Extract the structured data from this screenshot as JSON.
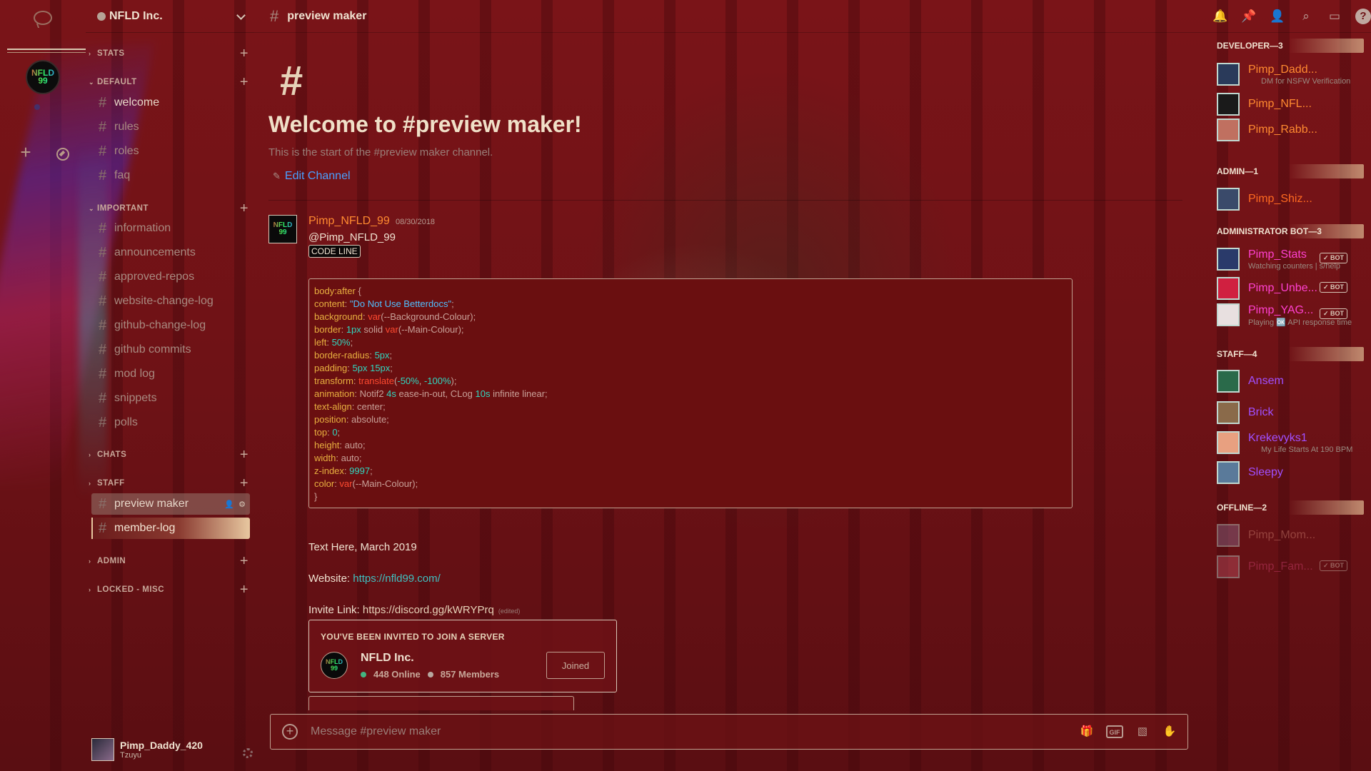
{
  "server": {
    "name": "NFLD Inc.",
    "icon_text": "NFLD 99"
  },
  "rail": {
    "icons": [
      "chat-bubble-icon",
      "add-server-icon",
      "explore-icon"
    ]
  },
  "sidebar": {
    "categories": [
      {
        "label": "STATS",
        "channels": []
      },
      {
        "label": "DEFAULT",
        "channels": [
          "welcome",
          "rules",
          "roles",
          "faq"
        ]
      },
      {
        "label": "IMPORTANT",
        "channels": [
          "information",
          "announcements",
          "approved-repos",
          "website-change-log",
          "github-change-log",
          "github commits",
          "mod log",
          "snippets",
          "polls"
        ]
      },
      {
        "label": "CHATS",
        "channels": []
      },
      {
        "label": "STAFF",
        "channels": [
          "preview maker",
          "member-log"
        ]
      },
      {
        "label": "ADMIN",
        "channels": []
      },
      {
        "label": "LOCKED - MISC",
        "channels": []
      }
    ]
  },
  "user_panel": {
    "username": "Pimp_Daddy_420",
    "status": "Tzuyu"
  },
  "channel": {
    "name": "preview maker",
    "welcome_hash": "#",
    "welcome_title": "Welcome to #preview maker!",
    "welcome_sub": "This is the start of the #preview maker channel.",
    "edit_label": "Edit Channel"
  },
  "message": {
    "author": "Pimp_NFLD_99",
    "timestamp": "08/30/2018",
    "mention": "@Pimp_NFLD_99",
    "code_line": "CODE LINE",
    "code": [
      [
        "body:after",
        " {"
      ],
      [
        "content",
        ": ",
        "\"Do Not Use Betterdocs\"",
        ";"
      ],
      [
        "background",
        ": ",
        "var",
        "(--Background-Colour);"
      ],
      [
        "border",
        ": ",
        "1px",
        " solid ",
        "var",
        "(--Main-Colour);"
      ],
      [
        "left",
        ": ",
        "50%",
        ";"
      ],
      [
        "border-radius",
        ": ",
        "5px",
        ";"
      ],
      [
        "padding",
        ": ",
        "5px 15px",
        ";"
      ],
      [
        "transform",
        ": ",
        "translate",
        "(",
        "-50%",
        ", ",
        "-100%",
        ");"
      ],
      [
        "animation",
        ": Notif2 ",
        "4s",
        " ease-in-out, CLog ",
        "10s",
        " infinite linear;"
      ],
      [
        "text-align",
        ": center;"
      ],
      [
        "position",
        ": absolute;"
      ],
      [
        "top",
        ": ",
        "0",
        ";"
      ],
      [
        "height",
        ": auto;"
      ],
      [
        "width",
        ": auto;"
      ],
      [
        "z-index",
        ": ",
        "9997",
        ";"
      ],
      [
        "color",
        ": ",
        "var",
        "(--Main-Colour);"
      ],
      [
        "}"
      ]
    ],
    "text_line": "Text Here, March 2019",
    "website_label": "Website: ",
    "website_url": "https://nfld99.com/",
    "invite_label": "Invite Link: ",
    "invite_url": "https://discord.gg/kWRYPrq",
    "edited": "(edited)"
  },
  "invite_card": {
    "heading": "YOU'VE BEEN INVITED TO JOIN A SERVER",
    "server_name": "NFLD Inc.",
    "online": "448 Online",
    "members": "857 Members",
    "button": "Joined"
  },
  "composer": {
    "placeholder": "Message #preview maker",
    "icons": [
      "gift-icon",
      "gif-icon",
      "sticker-icon",
      "emoji-icon"
    ],
    "gif_label": "GIF"
  },
  "header_tools": [
    "bell-icon",
    "pin-icon",
    "members-icon",
    "search-icon",
    "inbox-icon",
    "help-icon"
  ],
  "members": {
    "groups": [
      {
        "label": "DEVELOPER—3",
        "members": [
          {
            "name": "Pimp_Dadd...",
            "status": "DM for NSFW Verification",
            "color": "#ff8a30"
          },
          {
            "name": "Pimp_NFL...",
            "status": "",
            "color": "#ff8a30"
          },
          {
            "name": "Pimp_Rabb...",
            "status": "",
            "color": "#ff8a30"
          }
        ]
      },
      {
        "label": "ADMIN—1",
        "members": [
          {
            "name": "Pimp_Shiz...",
            "status": "",
            "color": "#ff6a20"
          }
        ]
      },
      {
        "label": "ADMINISTRATOR BOT—3",
        "members": [
          {
            "name": "Pimp_Stats",
            "status": "Watching counters | s/help",
            "color": "#ff40d0",
            "bot": "✓ BOT"
          },
          {
            "name": "Pimp_Unbe...",
            "status": "",
            "color": "#ff40d0",
            "bot": "✓ BOT"
          },
          {
            "name": "Pimp_YAG...",
            "status": "Playing 🆗 API response time",
            "color": "#ff40d0",
            "bot": "✓ BOT"
          }
        ]
      },
      {
        "label": "STAFF—4",
        "members": [
          {
            "name": "Ansem",
            "status": "",
            "color": "#a050ff"
          },
          {
            "name": "Brick",
            "status": "",
            "color": "#a050ff"
          },
          {
            "name": "Krekevyks1",
            "status": "My Life Starts At 190 BPM",
            "color": "#a050ff"
          },
          {
            "name": "Sleepy",
            "status": "",
            "color": "#a050ff"
          }
        ]
      },
      {
        "label": "OFFLINE—2",
        "members": [
          {
            "name": "Pimp_Mom...",
            "status": "",
            "color": "#d08070"
          },
          {
            "name": "Pimp_Fam...",
            "status": "",
            "color": "#d04070",
            "bot": "✓ BOT"
          }
        ]
      }
    ]
  }
}
